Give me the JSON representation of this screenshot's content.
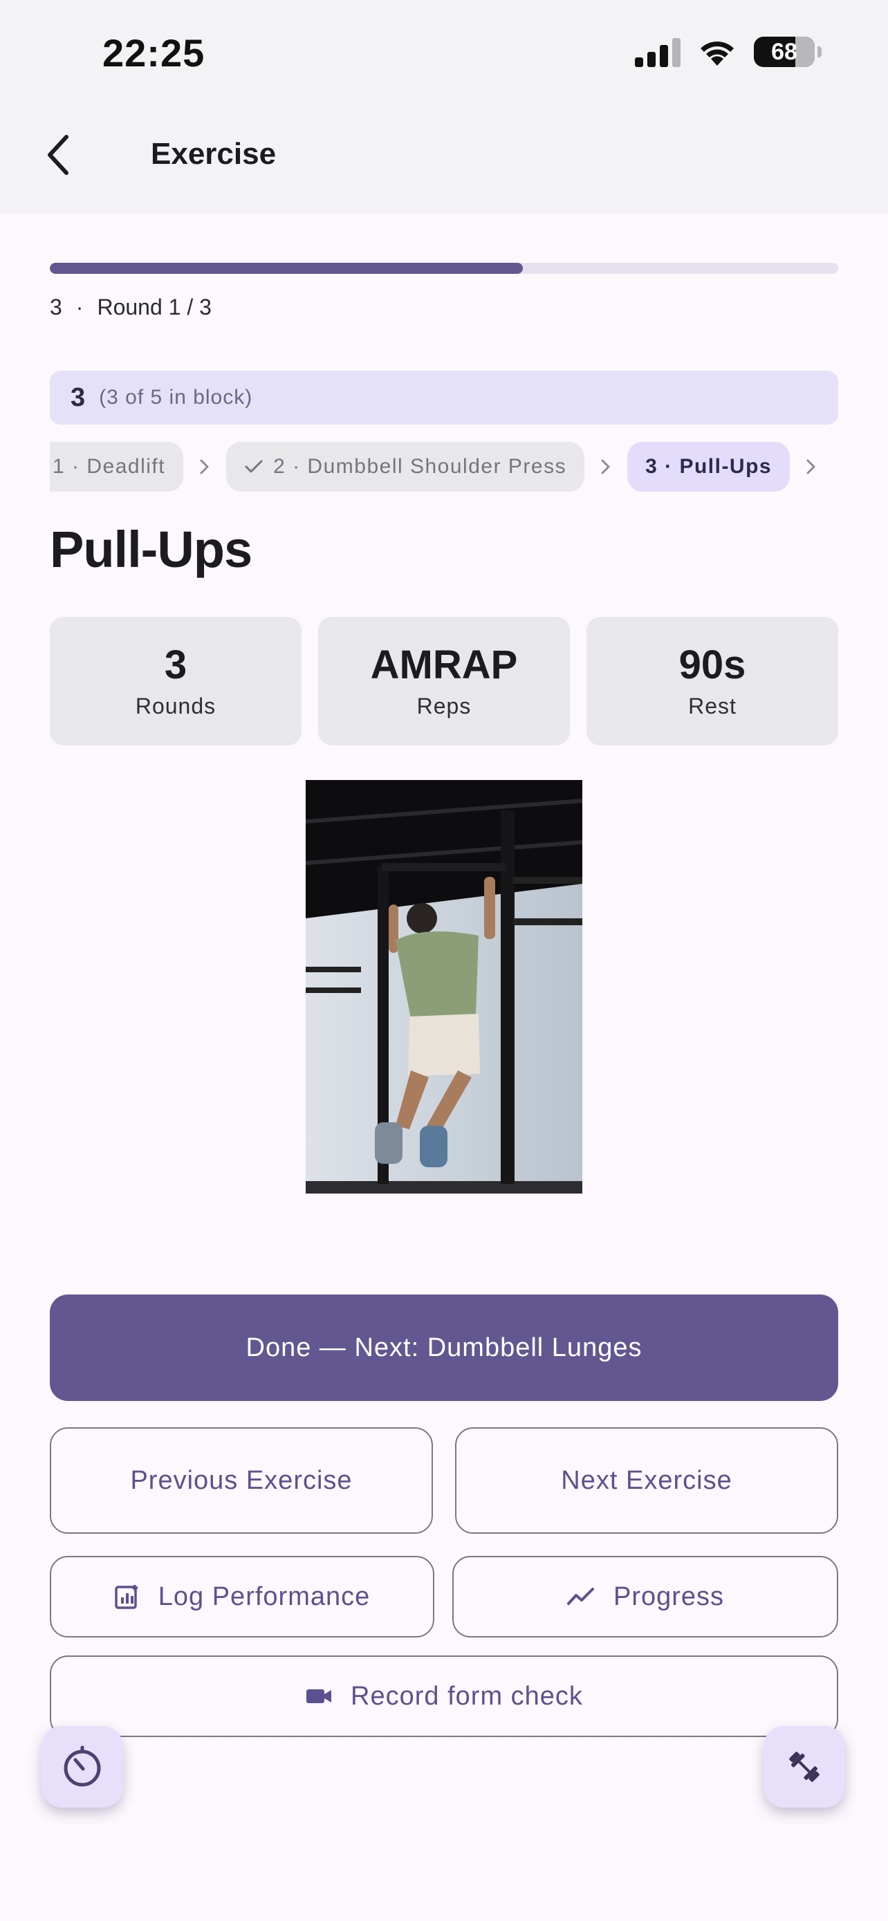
{
  "status_bar": {
    "time": "22:25",
    "battery": "68"
  },
  "app_bar": {
    "title": "Exercise",
    "back_icon": "chevron-left-icon"
  },
  "progress": {
    "fraction": 0.6
  },
  "round_info": {
    "exercise_number": "3",
    "separator": "·",
    "round": "Round 1 / 3"
  },
  "block": {
    "number": "3",
    "detail": "(3 of 5 in block)"
  },
  "chips": [
    {
      "label": "1 · Deadlift",
      "done": false,
      "active": false
    },
    {
      "label": "2 · Dumbbell Shoulder Press",
      "done": true,
      "active": false
    },
    {
      "label": "3 · Pull-Ups",
      "done": false,
      "active": true
    }
  ],
  "exercise": {
    "title": "Pull-Ups"
  },
  "stats": [
    {
      "value": "3",
      "label": "Rounds"
    },
    {
      "value": "AMRAP",
      "label": "Reps"
    },
    {
      "value": "90s",
      "label": "Rest"
    }
  ],
  "buttons": {
    "done_next": "Done — Next: Dumbbell Lunges",
    "previous": "Previous Exercise",
    "next": "Next Exercise",
    "log": "Log Performance",
    "progress": "Progress",
    "record": "Record form check"
  },
  "colors": {
    "primary": "#625790",
    "chip_active": "#e4dcfb",
    "banner": "#e4e1f8"
  }
}
